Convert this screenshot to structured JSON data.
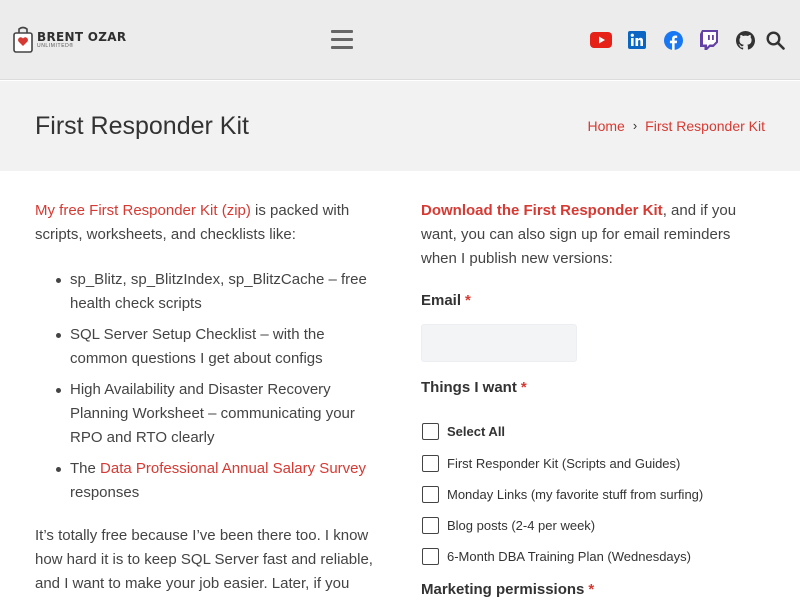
{
  "header": {
    "logo_text": "BRENT OZAR",
    "logo_subtext": "UNLIMITED®",
    "social": [
      {
        "name": "youtube-icon",
        "color": "#e62117"
      },
      {
        "name": "linkedin-icon",
        "color": "#0a66c2"
      },
      {
        "name": "facebook-icon",
        "color": "#1877f2"
      },
      {
        "name": "twitch-icon",
        "color": "#6441a5"
      },
      {
        "name": "github-icon",
        "color": "#333333"
      },
      {
        "name": "search-icon",
        "color": "#333333"
      }
    ]
  },
  "title_band": {
    "title": "First Responder Kit",
    "breadcrumb": {
      "home": "Home",
      "separator": "›",
      "current": "First Responder Kit"
    }
  },
  "left": {
    "intro_link": "My free First Responder Kit (zip)",
    "intro_rest": " is packed with scripts, worksheets, and checklists like:",
    "bullets": [
      {
        "text": "sp_Blitz, sp_BlitzIndex, sp_BlitzCache – free health check scripts"
      },
      {
        "text": "SQL Server Setup Checklist – with the common questions I get about configs"
      },
      {
        "text": "High Availability and Disaster Recovery Planning Worksheet – communicating your RPO and RTO clearly"
      },
      {
        "prefix": "The ",
        "link": "Data Professional Annual Salary Survey",
        "suffix": " responses"
      }
    ],
    "para2": "It’s totally free because I’ve been there too. I know how hard it is to keep SQL Server fast and reliable, and I want to make your job easier. Later, if you"
  },
  "right": {
    "intro_bold": "Download the First Responder Kit",
    "intro_rest": ", and if you want, you can also sign up for email reminders when I publish new versions:",
    "email_label": "Email",
    "email_value": "",
    "required_mark": "*",
    "things_label": "Things I want",
    "checkboxes": [
      {
        "label": "Select All",
        "checked": false,
        "bold": true
      },
      {
        "label": "First Responder Kit (Scripts and Guides)",
        "checked": false
      },
      {
        "label": "Monday Links (my favorite stuff from surfing)",
        "checked": false
      },
      {
        "label": "Blog posts (2-4 per week)",
        "checked": false
      },
      {
        "label": "6-Month DBA Training Plan (Wednesdays)",
        "checked": false
      }
    ],
    "marketing_label": "Marketing permissions"
  },
  "colors": {
    "accent": "#d63a33",
    "header_bg": "#ececec",
    "band_bg": "#f2f2f2"
  }
}
